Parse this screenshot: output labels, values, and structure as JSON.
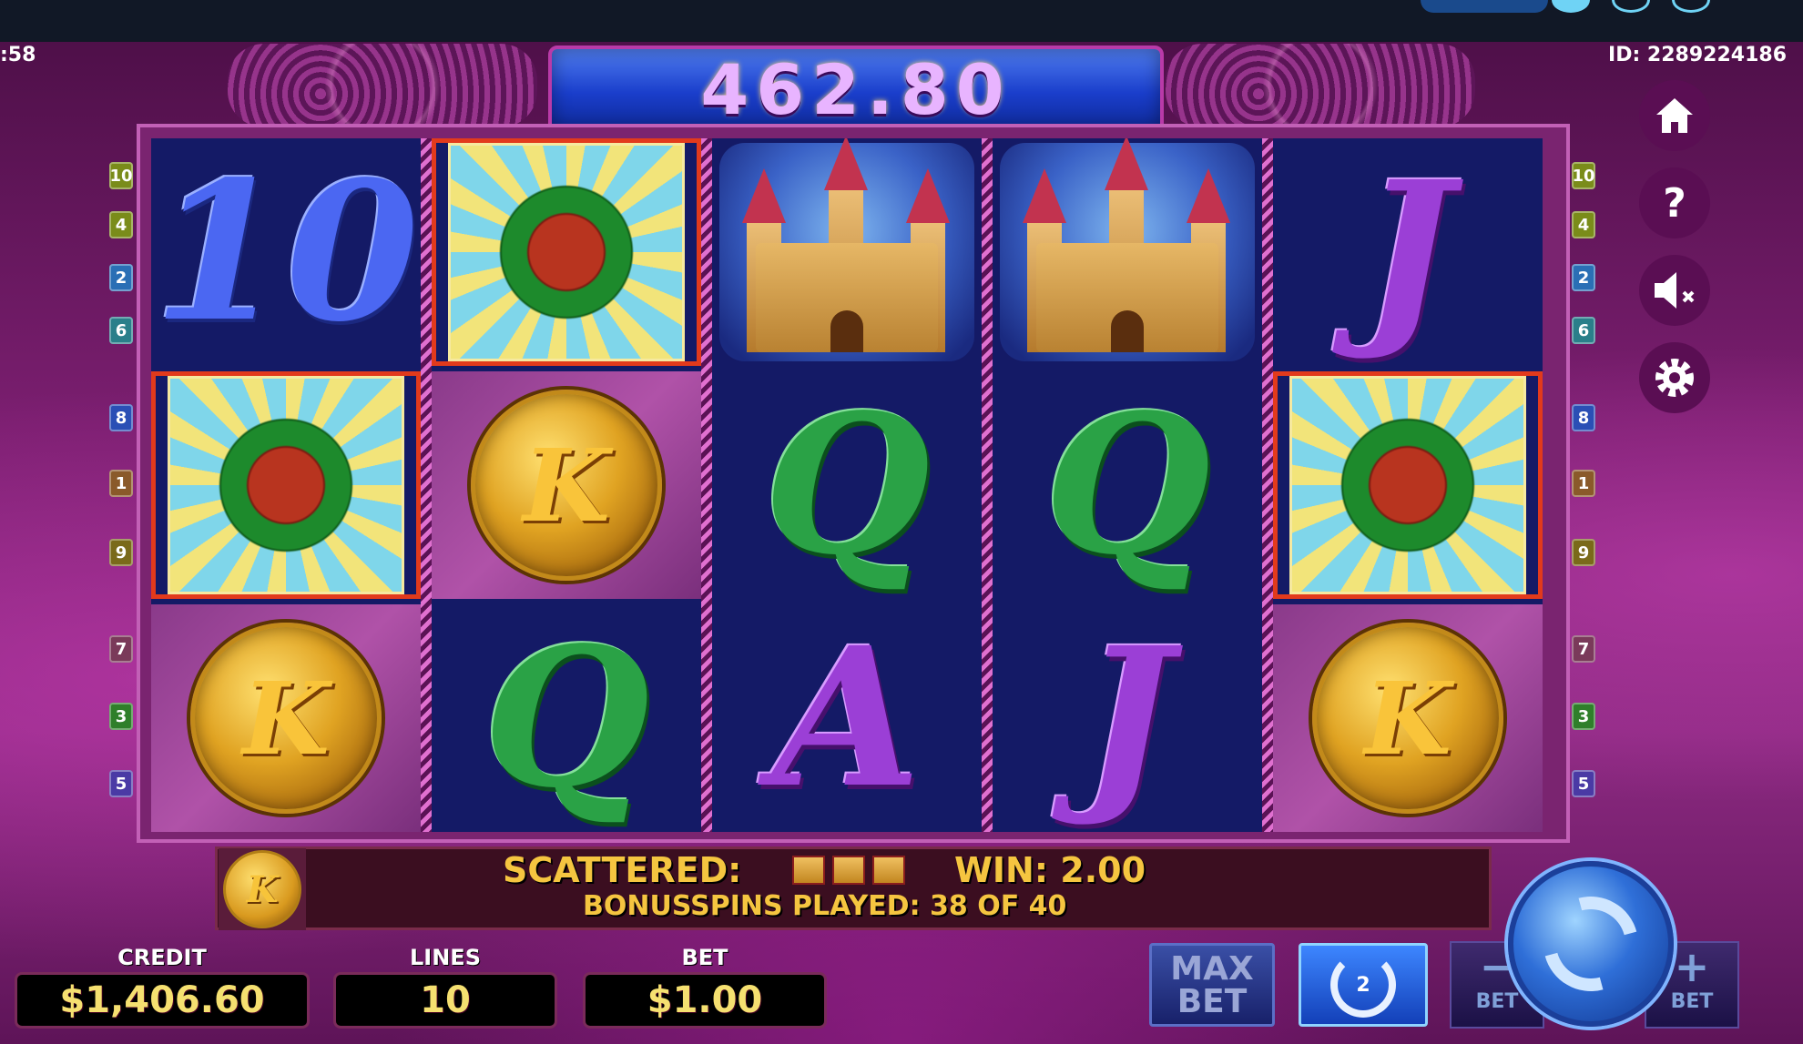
{
  "status": {
    "clock": ":58",
    "game_id": "ID: 2289224186"
  },
  "balance_display": "462.80",
  "reels": [
    [
      {
        "type": "letter",
        "text": "10",
        "color": "blue"
      },
      {
        "type": "sun",
        "win": true
      },
      {
        "type": "coin",
        "text": "K"
      }
    ],
    [
      {
        "type": "sun",
        "win": true
      },
      {
        "type": "coin",
        "text": "K"
      },
      {
        "type": "letter",
        "text": "Q",
        "color": "green"
      }
    ],
    [
      {
        "type": "castle"
      },
      {
        "type": "letter",
        "text": "Q",
        "color": "green"
      },
      {
        "type": "letter",
        "text": "A",
        "color": "purple"
      }
    ],
    [
      {
        "type": "castle"
      },
      {
        "type": "letter",
        "text": "Q",
        "color": "green"
      },
      {
        "type": "letter",
        "text": "J",
        "color": "purple"
      }
    ],
    [
      {
        "type": "letter",
        "text": "J",
        "color": "purple"
      },
      {
        "type": "sun",
        "win": true
      },
      {
        "type": "coin",
        "text": "K"
      }
    ]
  ],
  "line_markers": [
    {
      "num": "10",
      "color": "#7a8c1a"
    },
    {
      "num": "4",
      "color": "#7a8c1a"
    },
    {
      "num": "2",
      "color": "#2a6fb5"
    },
    {
      "num": "6",
      "color": "#2a7f8a"
    },
    {
      "num": "8",
      "color": "#2a4fb5"
    },
    {
      "num": "1",
      "color": "#8a5a2a"
    },
    {
      "num": "9",
      "color": "#7a6a1a"
    },
    {
      "num": "7",
      "color": "#7a3a5a"
    },
    {
      "num": "3",
      "color": "#2f7f2a"
    },
    {
      "num": "5",
      "color": "#4a3aa5"
    }
  ],
  "side_menu": {
    "home_icon": "home-icon",
    "help_icon": "help-icon",
    "sound_icon": "sound-muted-icon",
    "settings_icon": "gear-icon"
  },
  "info": {
    "coin_symbol": "K",
    "scattered_label": "SCATTERED:",
    "win_label": "WIN: 2.00",
    "bonus_text": "BONUSSPINS PLAYED: 38 OF 40"
  },
  "bottom": {
    "credit_label": "CREDIT",
    "credit_value": "$1,406.60",
    "lines_label": "LINES",
    "lines_value": "10",
    "bet_label": "BET",
    "bet_value": "$1.00",
    "max_bet_line1": "MAX",
    "max_bet_line2": "BET",
    "autoplay_count": "2",
    "bet_minus_symbol": "−",
    "bet_minus_label": "BET",
    "bet_plus_symbol": "+",
    "bet_plus_label": "BET"
  },
  "colors": {
    "accent_blue": "#1a3ecb",
    "gold_text": "#f5c540",
    "win_border": "#e23a1c"
  }
}
